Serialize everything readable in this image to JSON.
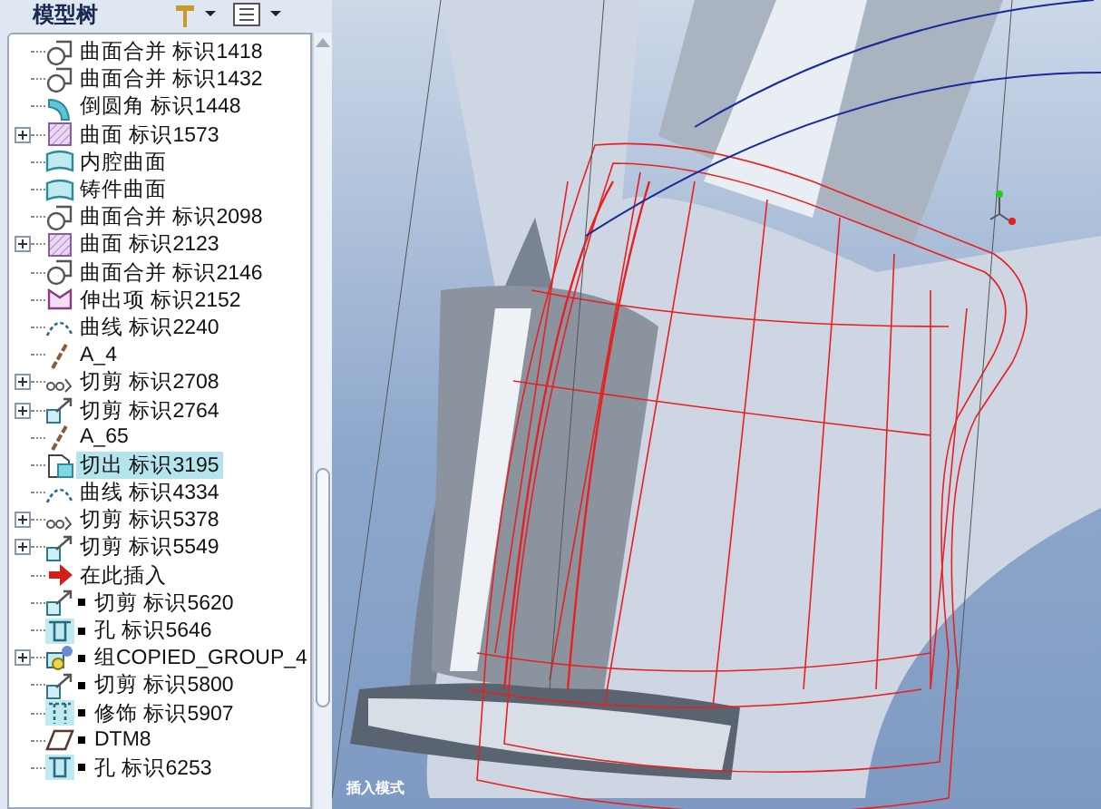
{
  "panel": {
    "title": "模型树"
  },
  "tree": {
    "items": [
      {
        "label": "曲面合并 标识1418",
        "kind": "merge",
        "expandable": false,
        "selected": false,
        "after_insert": false
      },
      {
        "label": "曲面合并 标识1432",
        "kind": "merge",
        "expandable": false,
        "selected": false,
        "after_insert": false
      },
      {
        "label": "倒圆角 标识1448",
        "kind": "round",
        "expandable": false,
        "selected": false,
        "after_insert": false
      },
      {
        "label": "曲面 标识1573",
        "kind": "surface",
        "expandable": true,
        "selected": false,
        "after_insert": false
      },
      {
        "label": "内腔曲面",
        "kind": "quilt",
        "expandable": false,
        "selected": false,
        "after_insert": false
      },
      {
        "label": "铸件曲面",
        "kind": "quilt",
        "expandable": false,
        "selected": false,
        "after_insert": false
      },
      {
        "label": "曲面合并 标识2098",
        "kind": "merge",
        "expandable": false,
        "selected": false,
        "after_insert": false
      },
      {
        "label": "曲面 标识2123",
        "kind": "surface",
        "expandable": true,
        "selected": false,
        "after_insert": false
      },
      {
        "label": "曲面合并 标识2146",
        "kind": "merge",
        "expandable": false,
        "selected": false,
        "after_insert": false
      },
      {
        "label": "伸出项 标识2152",
        "kind": "protrusion",
        "expandable": false,
        "selected": false,
        "after_insert": false
      },
      {
        "label": "曲线 标识2240",
        "kind": "curve",
        "expandable": false,
        "selected": false,
        "after_insert": false
      },
      {
        "label": "A_4",
        "kind": "axis",
        "expandable": false,
        "selected": false,
        "after_insert": false
      },
      {
        "label": "切剪 标识2708",
        "kind": "chain",
        "expandable": true,
        "selected": false,
        "after_insert": false
      },
      {
        "label": "切剪 标识2764",
        "kind": "cut",
        "expandable": true,
        "selected": false,
        "after_insert": false
      },
      {
        "label": "A_65",
        "kind": "axis",
        "expandable": false,
        "selected": false,
        "after_insert": false
      },
      {
        "label": "切出 标识3195",
        "kind": "solid",
        "expandable": false,
        "selected": true,
        "after_insert": false
      },
      {
        "label": "曲线 标识4334",
        "kind": "curve",
        "expandable": false,
        "selected": false,
        "after_insert": false
      },
      {
        "label": "切剪 标识5378",
        "kind": "chain",
        "expandable": true,
        "selected": false,
        "after_insert": false
      },
      {
        "label": "切剪 标识5549",
        "kind": "cut",
        "expandable": true,
        "selected": false,
        "after_insert": false
      },
      {
        "label": "在此插入",
        "kind": "insert",
        "expandable": false,
        "selected": false,
        "after_insert": false
      },
      {
        "label": "切剪 标识5620",
        "kind": "cut",
        "expandable": false,
        "selected": false,
        "after_insert": true
      },
      {
        "label": "孔 标识5646",
        "kind": "hole",
        "expandable": false,
        "selected": false,
        "after_insert": true
      },
      {
        "label": "组COPIED_GROUP_4",
        "kind": "group",
        "expandable": true,
        "selected": false,
        "after_insert": true
      },
      {
        "label": "切剪 标识5800",
        "kind": "cut",
        "expandable": false,
        "selected": false,
        "after_insert": true
      },
      {
        "label": "修饰 标识5907",
        "kind": "cosmetic",
        "expandable": false,
        "selected": false,
        "after_insert": true
      },
      {
        "label": "DTM8",
        "kind": "plane",
        "expandable": false,
        "selected": false,
        "after_insert": true
      },
      {
        "label": "孔 标识6253",
        "kind": "hole",
        "expandable": false,
        "selected": false,
        "after_insert": true
      }
    ]
  },
  "viewport": {
    "mode_label": "插入模式"
  }
}
